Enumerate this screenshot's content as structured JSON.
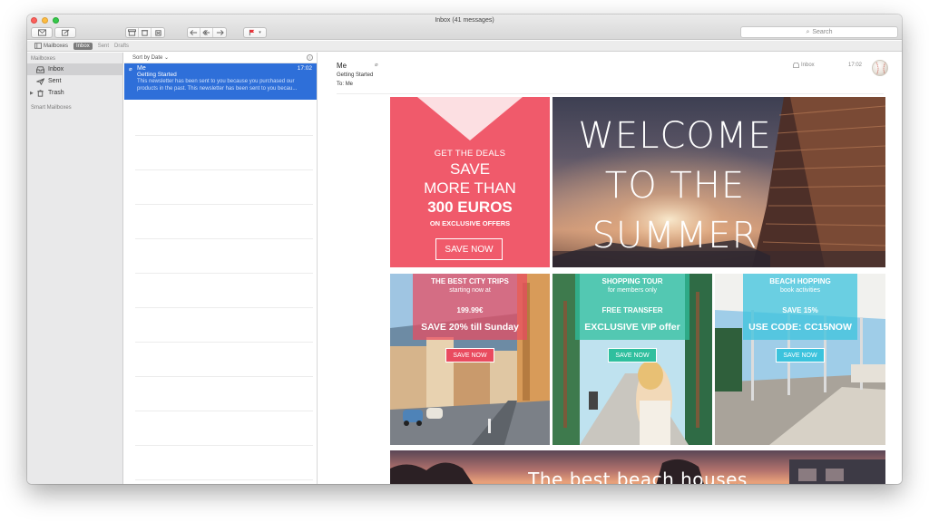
{
  "window": {
    "title": "Inbox (41 messages)"
  },
  "toolbar": {
    "search_placeholder": "Search",
    "icons": [
      "compose-icon",
      "get-mail-icon",
      "archive-icon",
      "delete-icon",
      "junk-icon",
      "reply-icon",
      "reply-all-icon",
      "forward-icon",
      "flag-icon"
    ]
  },
  "favorites": {
    "mailboxes": "Mailboxes",
    "inbox": "Inbox",
    "sent": "Sent",
    "drafts": "Drafts"
  },
  "sidebar": {
    "heading": "Mailboxes",
    "items": [
      {
        "label": "Inbox",
        "icon": "inbox-icon",
        "selected": true
      },
      {
        "label": "Sent",
        "icon": "sent-icon"
      },
      {
        "label": "Trash",
        "icon": "trash-icon"
      }
    ],
    "smart_heading": "Smart Mailboxes"
  },
  "message_list": {
    "sort_label": "Sort by Date",
    "messages": [
      {
        "from": "Me",
        "time": "17:02",
        "subject": "Getting Started",
        "preview_line1": "This newsletter has been sent to you because you purchased our",
        "preview_line2": "products in the past. This newsletter has been sent to you becau..."
      }
    ]
  },
  "message": {
    "from": "Me",
    "subject": "Getting Started",
    "to_label": "To:",
    "to": "Me",
    "mailbox": "Inbox",
    "time": "17:02"
  },
  "newsletter": {
    "deal": {
      "line1": "GET THE DEALS",
      "line2": "SAVE",
      "line3": "MORE THAN",
      "line4": "300 EUROS",
      "line5": "ON EXCLUSIVE OFFERS",
      "button": "SAVE NOW",
      "color": "#f05a6b"
    },
    "hero": {
      "line1": "WELCOME",
      "line2": "TO THE",
      "line3": "SUMMER"
    },
    "tiles": [
      {
        "title": "THE BEST CITY TRIPS",
        "subtitle": "starting now at",
        "line3": "199.99€",
        "line4": "SAVE 20% till Sunday",
        "button": "SAVE NOW",
        "accent": "#e94b5f"
      },
      {
        "title": "SHOPPING TOUR",
        "subtitle": "for members only",
        "line3": "FREE TRANSFER",
        "line4": "EXCLUSIVE VIP offer",
        "button": "SAVE NOW",
        "accent": "#2fbf9e"
      },
      {
        "title": "BEACH HOPPING",
        "subtitle": "book activities",
        "line3": "SAVE 15%",
        "line4": "USE CODE: CC15NOW",
        "button": "SAVE NOW",
        "accent": "#3cc3dd"
      }
    ],
    "banner": "The best beach houses"
  }
}
